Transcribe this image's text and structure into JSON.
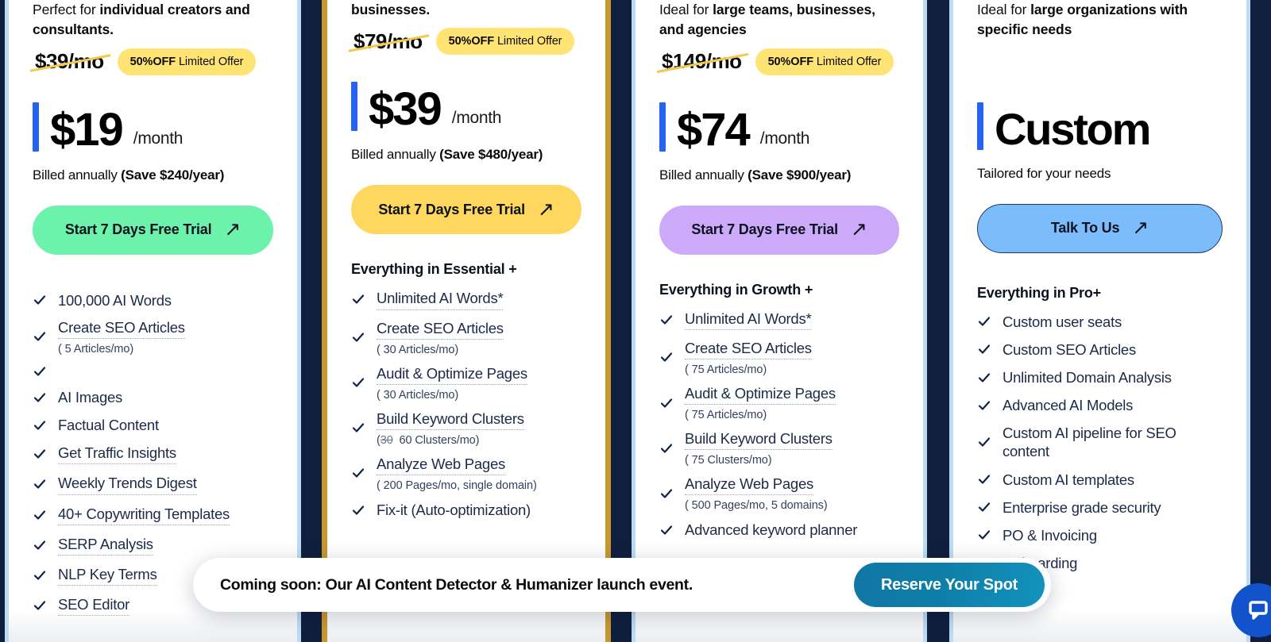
{
  "theme": {
    "page_bg": "#0f1f3d",
    "card_bg": "#ffffff",
    "accent_blue": "#2563f0",
    "light_blue_rail": "#bcdcf2",
    "gold_rail": "#c8982f",
    "badge_bg": "#ffe373",
    "cta_green": "#6df2ab",
    "cta_yellow": "#ffd75e",
    "cta_purple": "#cda9fa",
    "cta_blue": "#7cbcfb",
    "banner_btn": "#0e7ea8",
    "chat_widget": "#1253cc"
  },
  "plans": [
    {
      "id": "essential",
      "tagline_prefix": "Perfect for ",
      "tagline_bold": "individual creators and consultants.",
      "old_price": "$39/mo",
      "badge_bold": "50%OFF",
      "badge_rest": " Limited Offer",
      "price": "$19",
      "price_period": "/month",
      "billed_prefix": "Billed annually ",
      "billed_bold": "(Save $240/year)",
      "cta_label": "Start 7 Days Free Trial",
      "cta_arrow": "↗",
      "cta_style": "green",
      "features_header": "",
      "features": [
        {
          "label": "100,000 AI Words",
          "sub": "",
          "dotted": false
        },
        {
          "label": "Create SEO Articles",
          "sub": "( 5 Articles/mo)",
          "dotted": true
        },
        {
          "label": "",
          "sub": "",
          "dotted": false
        },
        {
          "label": "AI Images",
          "sub": "",
          "dotted": false
        },
        {
          "label": "Factual Content",
          "sub": "",
          "dotted": false
        },
        {
          "label": "Get Traffic Insights",
          "sub": "",
          "dotted": true
        },
        {
          "label": "Weekly Trends Digest",
          "sub": "",
          "dotted": true
        },
        {
          "label": "40+ Copywriting Templates",
          "sub": "",
          "dotted": true
        },
        {
          "label": "SERP Analysis",
          "sub": "",
          "dotted": true
        },
        {
          "label": "NLP Key Terms",
          "sub": "",
          "dotted": true
        },
        {
          "label": "SEO Editor",
          "sub": "",
          "dotted": true
        }
      ]
    },
    {
      "id": "growth",
      "tagline_prefix": "",
      "tagline_bold": "businesses.",
      "old_price": "$79/mo",
      "badge_bold": "50%OFF",
      "badge_rest": " Limited Offer",
      "price": "$39",
      "price_period": "/month",
      "billed_prefix": "Billed annually ",
      "billed_bold": "(Save $480/year)",
      "cta_label": "Start 7 Days Free Trial",
      "cta_arrow": "↗",
      "cta_style": "yellow",
      "features_header": "Everything in Essential +",
      "features": [
        {
          "label": "Unlimited AI Words*",
          "sub": "",
          "dotted": true
        },
        {
          "label": "Create SEO Articles",
          "sub": "( 30 Articles/mo)",
          "dotted": true
        },
        {
          "label": "Audit & Optimize Pages",
          "sub": "( 30 Articles/mo)",
          "dotted": true
        },
        {
          "label": "Build Keyword Clusters",
          "sub": "(30  60 Clusters/mo)",
          "sub_strike": "30",
          "dotted": true
        },
        {
          "label": "Analyze Web Pages",
          "sub": "( 200 Pages/mo, single domain)",
          "dotted": true
        },
        {
          "label": "Fix-it (Auto-optimization)",
          "sub": "",
          "dotted": false
        }
      ]
    },
    {
      "id": "pro",
      "tagline_prefix": "Ideal for ",
      "tagline_bold": "large teams, businesses, and agencies",
      "old_price": "$149/mo",
      "badge_bold": "50%OFF",
      "badge_rest": " Limited Offer",
      "price": "$74",
      "price_period": "/month",
      "billed_prefix": "Billed annually ",
      "billed_bold": "(Save $900/year)",
      "cta_label": "Start 7 Days Free Trial",
      "cta_arrow": "↗",
      "cta_style": "purple",
      "features_header": "Everything in Growth +",
      "features": [
        {
          "label": "Unlimited AI Words*",
          "sub": "",
          "dotted": true
        },
        {
          "label": "Create SEO Articles",
          "sub": "( 75 Articles/mo)",
          "dotted": true
        },
        {
          "label": "Audit & Optimize Pages",
          "sub": "( 75 Articles/mo)",
          "dotted": true
        },
        {
          "label": "Build Keyword Clusters",
          "sub": "( 75  Clusters/mo)",
          "dotted": true
        },
        {
          "label": "Analyze Web Pages",
          "sub": "( 500  Pages/mo, 5 domains)",
          "dotted": true
        },
        {
          "label": "Advanced keyword planner",
          "sub": "",
          "dotted": false
        }
      ]
    },
    {
      "id": "enterprise",
      "tagline_prefix": "Ideal for ",
      "tagline_bold": "large organizations with specific needs",
      "old_price": "",
      "badge_bold": "",
      "badge_rest": "",
      "price": "Custom",
      "price_period": "",
      "billed_prefix": "Tailored for your needs",
      "billed_bold": "",
      "cta_label": "Talk To Us",
      "cta_arrow": "↗",
      "cta_style": "blue",
      "features_header": "Everything in Pro+",
      "features": [
        {
          "label": "Custom user seats",
          "sub": "",
          "dotted": false
        },
        {
          "label": "Custom SEO Articles",
          "sub": "",
          "dotted": false
        },
        {
          "label": "Unlimited Domain Analysis",
          "sub": "",
          "dotted": false
        },
        {
          "label": "Advanced AI Models",
          "sub": "",
          "dotted": false
        },
        {
          "label": "Custom AI pipeline for SEO content",
          "sub": "",
          "dotted": false
        },
        {
          "label": "Custom AI templates",
          "sub": "",
          "dotted": false
        },
        {
          "label": "Enterprise grade security",
          "sub": "",
          "dotted": false
        },
        {
          "label": "PO & Invoicing",
          "sub": "",
          "dotted": false
        },
        {
          "label": "Onboarding",
          "sub": "",
          "dotted": false
        }
      ]
    }
  ],
  "banner": {
    "message": "Coming soon: Our AI Content Detector & Humanizer launch event.",
    "cta_label": "Reserve Your Spot"
  },
  "chat_widget": {
    "icon": "chat-bubble-icon"
  }
}
